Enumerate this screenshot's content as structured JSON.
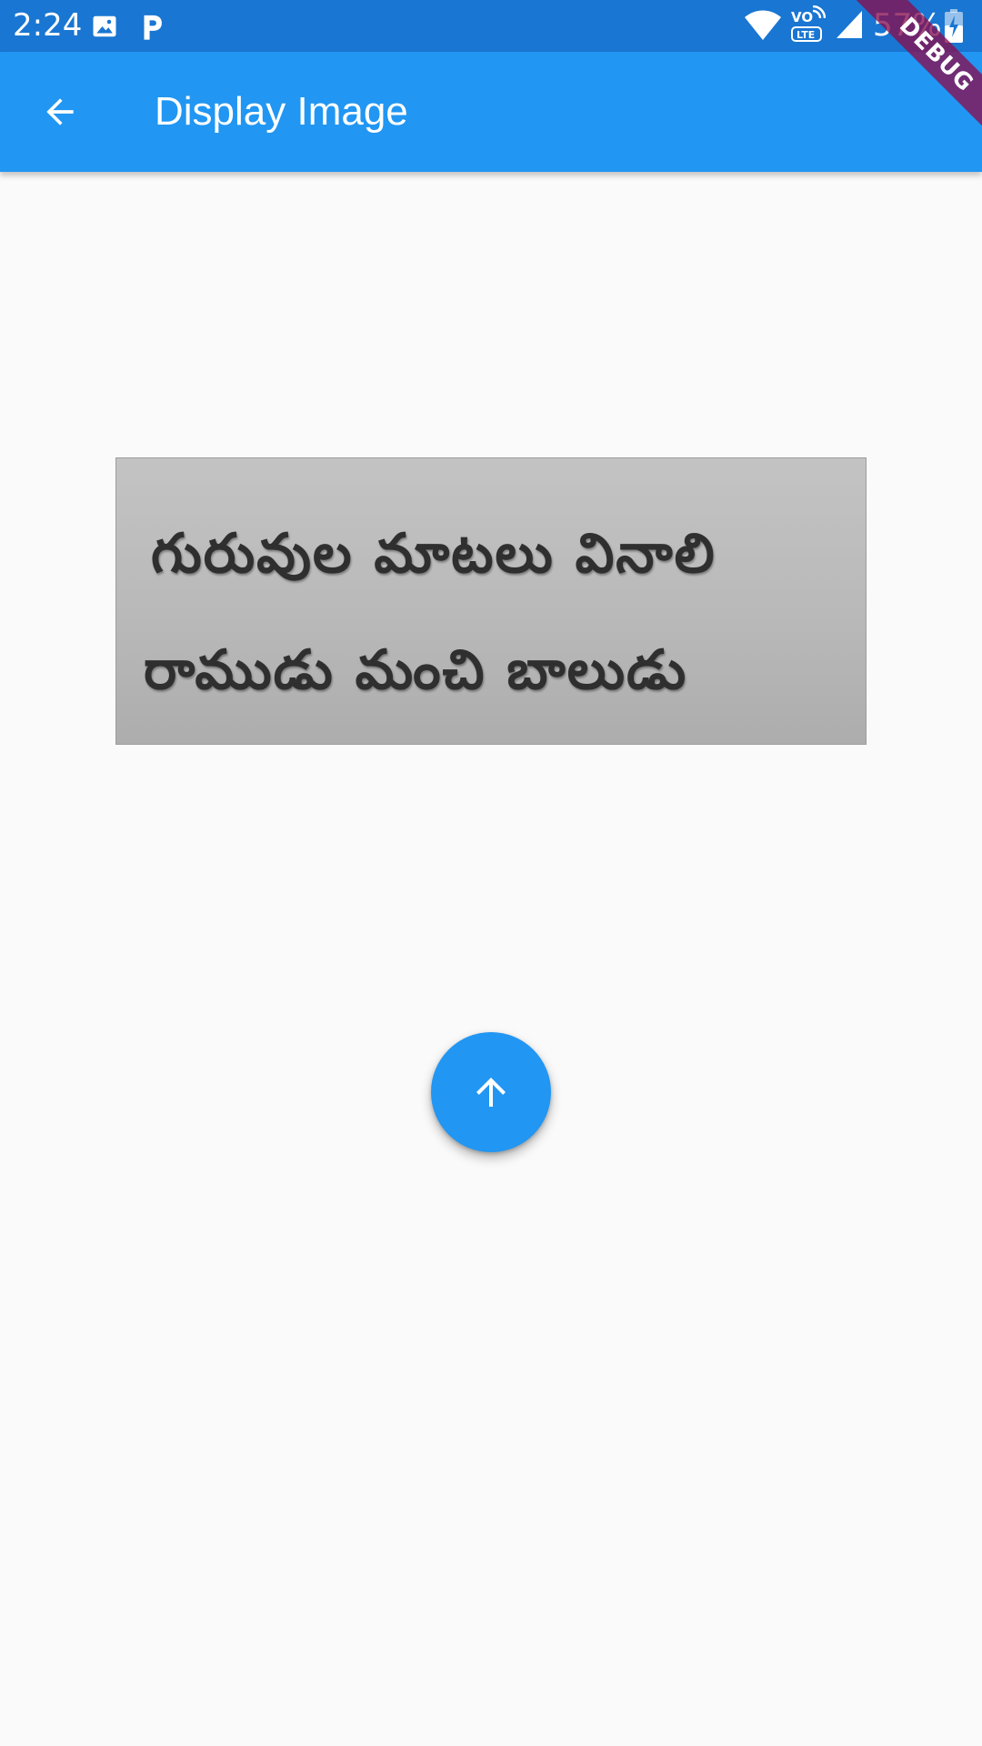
{
  "status_bar": {
    "time": "2:24",
    "battery_percent": "57%",
    "icons": [
      "image-icon",
      "p-app-icon",
      "wifi-icon",
      "volte-lte-icon",
      "signal-icon",
      "battery-icon"
    ],
    "background_color": "#1976d2"
  },
  "app_bar": {
    "title": "Display Image",
    "back_icon": "arrow-back-icon",
    "background_color": "#2196f3"
  },
  "debug_banner": {
    "label": "DEBUG"
  },
  "displayed_image": {
    "line_1": "గురువుల మాటలు వినాలి",
    "line_2": "రాముడు మంచి బాలుడు"
  },
  "fab": {
    "icon": "arrow-upward-icon",
    "background_color": "#2196f3"
  }
}
